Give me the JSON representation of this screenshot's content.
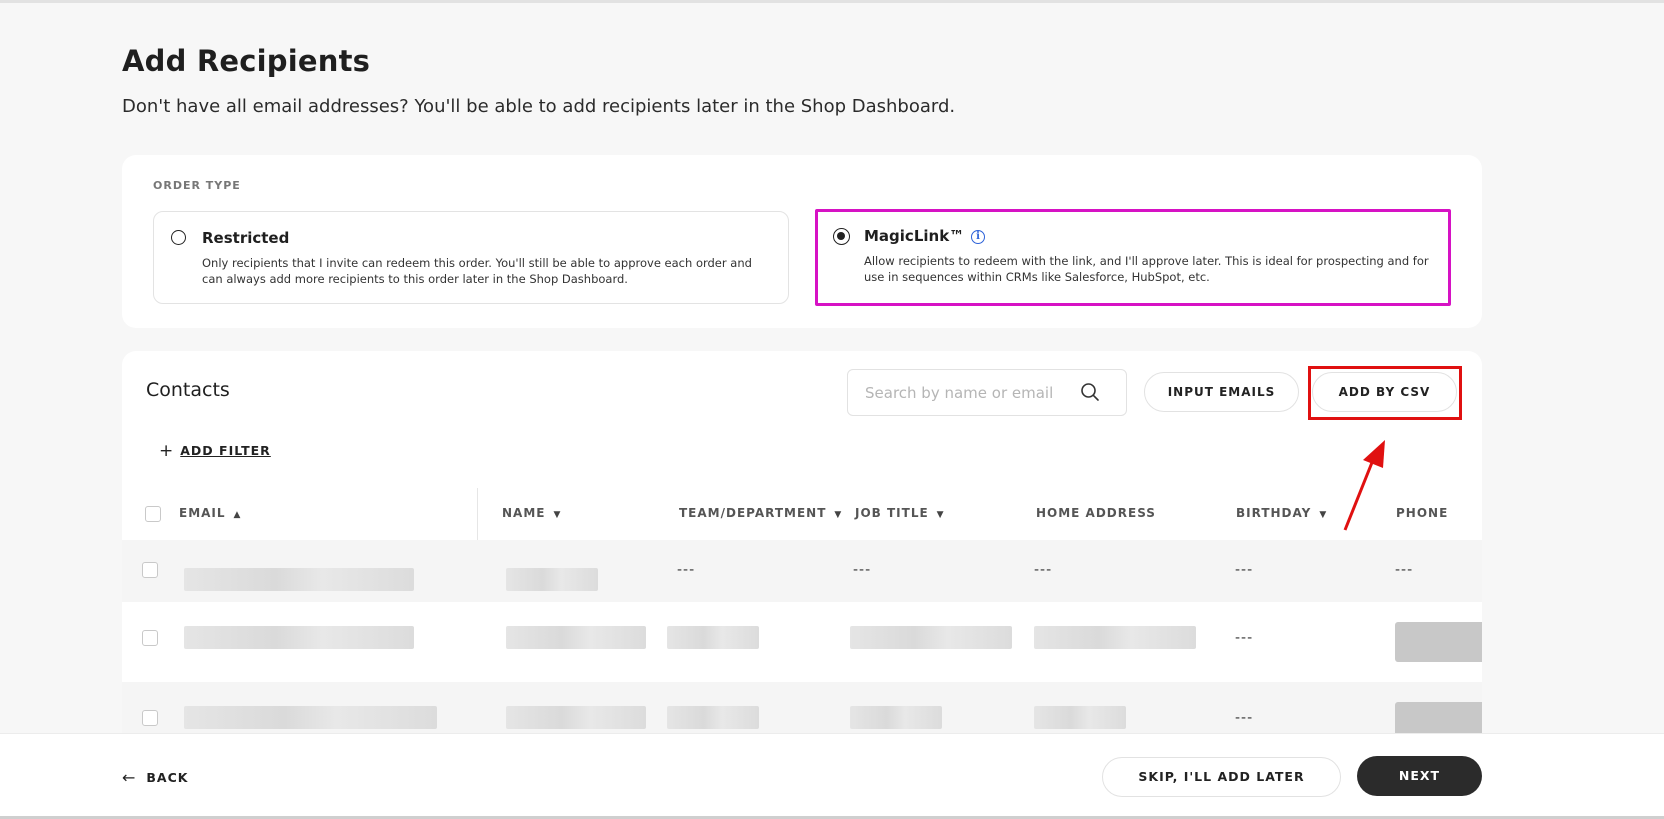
{
  "page": {
    "title": "Add Recipients",
    "subtitle": "Don't have all email addresses? You'll be able to add recipients later in the Shop Dashboard."
  },
  "order_type": {
    "label": "ORDER TYPE",
    "options": [
      {
        "title": "Restricted",
        "description": "Only recipients that I invite can redeem this order. You'll still be able to approve each order and can always add more recipients to this order later in the Shop Dashboard.",
        "selected": false
      },
      {
        "title": "MagicLink™",
        "description": "Allow recipients to redeem with the link, and I'll approve later. This is ideal for prospecting and for use in sequences within CRMs like Salesforce, HubSpot, etc.",
        "selected": true,
        "info_icon": "info-icon"
      }
    ]
  },
  "contacts": {
    "title": "Contacts",
    "search_placeholder": "Search by name or email",
    "input_emails_label": "INPUT EMAILS",
    "add_csv_label": "ADD BY CSV",
    "add_filter_label": "ADD FILTER",
    "columns": [
      {
        "label": "EMAIL",
        "sort": "asc"
      },
      {
        "label": "NAME",
        "sort": "dropdown"
      },
      {
        "label": "TEAM/DEPARTMENT",
        "sort": "dropdown"
      },
      {
        "label": "JOB TITLE",
        "sort": "dropdown"
      },
      {
        "label": "HOME ADDRESS"
      },
      {
        "label": "BIRTHDAY",
        "sort": "dropdown"
      },
      {
        "label": "PHONE"
      }
    ],
    "rows": [
      {
        "team": "---",
        "job": "---",
        "address": "---",
        "birthday": "---",
        "phone": "---"
      },
      {
        "birthday": "---"
      },
      {
        "birthday": "---"
      }
    ]
  },
  "footer": {
    "back_label": "BACK",
    "skip_label": "SKIP, I'LL ADD LATER",
    "next_label": "NEXT"
  },
  "colors": {
    "magiclink_highlight": "#d612c4",
    "csv_highlight": "#e01010",
    "primary_button": "#2b2b2b",
    "info_icon": "#2d62d8"
  }
}
